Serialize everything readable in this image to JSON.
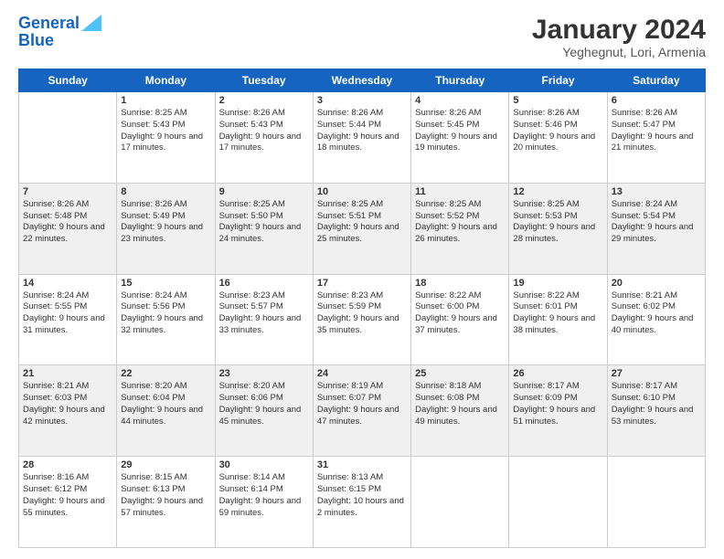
{
  "header": {
    "logo_line1": "General",
    "logo_line2": "Blue",
    "title": "January 2024",
    "location": "Yeghegnut, Lori, Armenia"
  },
  "days_of_week": [
    "Sunday",
    "Monday",
    "Tuesday",
    "Wednesday",
    "Thursday",
    "Friday",
    "Saturday"
  ],
  "weeks": [
    [
      {
        "day": "",
        "content": ""
      },
      {
        "day": "1",
        "sunrise": "Sunrise: 8:25 AM",
        "sunset": "Sunset: 5:43 PM",
        "daylight": "Daylight: 9 hours and 17 minutes."
      },
      {
        "day": "2",
        "sunrise": "Sunrise: 8:26 AM",
        "sunset": "Sunset: 5:43 PM",
        "daylight": "Daylight: 9 hours and 17 minutes."
      },
      {
        "day": "3",
        "sunrise": "Sunrise: 8:26 AM",
        "sunset": "Sunset: 5:44 PM",
        "daylight": "Daylight: 9 hours and 18 minutes."
      },
      {
        "day": "4",
        "sunrise": "Sunrise: 8:26 AM",
        "sunset": "Sunset: 5:45 PM",
        "daylight": "Daylight: 9 hours and 19 minutes."
      },
      {
        "day": "5",
        "sunrise": "Sunrise: 8:26 AM",
        "sunset": "Sunset: 5:46 PM",
        "daylight": "Daylight: 9 hours and 20 minutes."
      },
      {
        "day": "6",
        "sunrise": "Sunrise: 8:26 AM",
        "sunset": "Sunset: 5:47 PM",
        "daylight": "Daylight: 9 hours and 21 minutes."
      }
    ],
    [
      {
        "day": "7",
        "sunrise": "Sunrise: 8:26 AM",
        "sunset": "Sunset: 5:48 PM",
        "daylight": "Daylight: 9 hours and 22 minutes."
      },
      {
        "day": "8",
        "sunrise": "Sunrise: 8:26 AM",
        "sunset": "Sunset: 5:49 PM",
        "daylight": "Daylight: 9 hours and 23 minutes."
      },
      {
        "day": "9",
        "sunrise": "Sunrise: 8:25 AM",
        "sunset": "Sunset: 5:50 PM",
        "daylight": "Daylight: 9 hours and 24 minutes."
      },
      {
        "day": "10",
        "sunrise": "Sunrise: 8:25 AM",
        "sunset": "Sunset: 5:51 PM",
        "daylight": "Daylight: 9 hours and 25 minutes."
      },
      {
        "day": "11",
        "sunrise": "Sunrise: 8:25 AM",
        "sunset": "Sunset: 5:52 PM",
        "daylight": "Daylight: 9 hours and 26 minutes."
      },
      {
        "day": "12",
        "sunrise": "Sunrise: 8:25 AM",
        "sunset": "Sunset: 5:53 PM",
        "daylight": "Daylight: 9 hours and 28 minutes."
      },
      {
        "day": "13",
        "sunrise": "Sunrise: 8:24 AM",
        "sunset": "Sunset: 5:54 PM",
        "daylight": "Daylight: 9 hours and 29 minutes."
      }
    ],
    [
      {
        "day": "14",
        "sunrise": "Sunrise: 8:24 AM",
        "sunset": "Sunset: 5:55 PM",
        "daylight": "Daylight: 9 hours and 31 minutes."
      },
      {
        "day": "15",
        "sunrise": "Sunrise: 8:24 AM",
        "sunset": "Sunset: 5:56 PM",
        "daylight": "Daylight: 9 hours and 32 minutes."
      },
      {
        "day": "16",
        "sunrise": "Sunrise: 8:23 AM",
        "sunset": "Sunset: 5:57 PM",
        "daylight": "Daylight: 9 hours and 33 minutes."
      },
      {
        "day": "17",
        "sunrise": "Sunrise: 8:23 AM",
        "sunset": "Sunset: 5:59 PM",
        "daylight": "Daylight: 9 hours and 35 minutes."
      },
      {
        "day": "18",
        "sunrise": "Sunrise: 8:22 AM",
        "sunset": "Sunset: 6:00 PM",
        "daylight": "Daylight: 9 hours and 37 minutes."
      },
      {
        "day": "19",
        "sunrise": "Sunrise: 8:22 AM",
        "sunset": "Sunset: 6:01 PM",
        "daylight": "Daylight: 9 hours and 38 minutes."
      },
      {
        "day": "20",
        "sunrise": "Sunrise: 8:21 AM",
        "sunset": "Sunset: 6:02 PM",
        "daylight": "Daylight: 9 hours and 40 minutes."
      }
    ],
    [
      {
        "day": "21",
        "sunrise": "Sunrise: 8:21 AM",
        "sunset": "Sunset: 6:03 PM",
        "daylight": "Daylight: 9 hours and 42 minutes."
      },
      {
        "day": "22",
        "sunrise": "Sunrise: 8:20 AM",
        "sunset": "Sunset: 6:04 PM",
        "daylight": "Daylight: 9 hours and 44 minutes."
      },
      {
        "day": "23",
        "sunrise": "Sunrise: 8:20 AM",
        "sunset": "Sunset: 6:06 PM",
        "daylight": "Daylight: 9 hours and 45 minutes."
      },
      {
        "day": "24",
        "sunrise": "Sunrise: 8:19 AM",
        "sunset": "Sunset: 6:07 PM",
        "daylight": "Daylight: 9 hours and 47 minutes."
      },
      {
        "day": "25",
        "sunrise": "Sunrise: 8:18 AM",
        "sunset": "Sunset: 6:08 PM",
        "daylight": "Daylight: 9 hours and 49 minutes."
      },
      {
        "day": "26",
        "sunrise": "Sunrise: 8:17 AM",
        "sunset": "Sunset: 6:09 PM",
        "daylight": "Daylight: 9 hours and 51 minutes."
      },
      {
        "day": "27",
        "sunrise": "Sunrise: 8:17 AM",
        "sunset": "Sunset: 6:10 PM",
        "daylight": "Daylight: 9 hours and 53 minutes."
      }
    ],
    [
      {
        "day": "28",
        "sunrise": "Sunrise: 8:16 AM",
        "sunset": "Sunset: 6:12 PM",
        "daylight": "Daylight: 9 hours and 55 minutes."
      },
      {
        "day": "29",
        "sunrise": "Sunrise: 8:15 AM",
        "sunset": "Sunset: 6:13 PM",
        "daylight": "Daylight: 9 hours and 57 minutes."
      },
      {
        "day": "30",
        "sunrise": "Sunrise: 8:14 AM",
        "sunset": "Sunset: 6:14 PM",
        "daylight": "Daylight: 9 hours and 59 minutes."
      },
      {
        "day": "31",
        "sunrise": "Sunrise: 8:13 AM",
        "sunset": "Sunset: 6:15 PM",
        "daylight": "Daylight: 10 hours and 2 minutes."
      },
      {
        "day": "",
        "content": ""
      },
      {
        "day": "",
        "content": ""
      },
      {
        "day": "",
        "content": ""
      }
    ]
  ]
}
